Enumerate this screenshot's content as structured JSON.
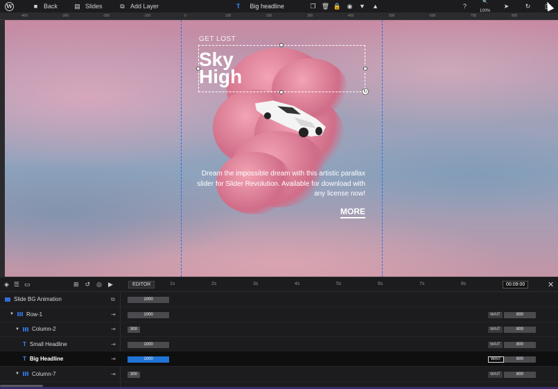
{
  "topbar": {
    "back_label": "Back",
    "slides_label": "Slides",
    "add_layer_label": "Add Layer",
    "layer_type_glyph": "T",
    "layer_name": "Big headline",
    "zoom_label": "100%"
  },
  "ruler": {
    "ticks": [
      "-400",
      "-300",
      "-200",
      "-100",
      "0",
      "100",
      "200",
      "300",
      "400",
      "500",
      "600",
      "700",
      "800"
    ]
  },
  "slide": {
    "eyebrow": "GET LOST",
    "headline_line1": "Sky",
    "headline_line2": "High",
    "description": "Dream the impossible dream with this artistic parallax slider for Slider Revolution. Available for download with any license now!",
    "cta": "MORE"
  },
  "timeline": {
    "editor_label": "EDITOR",
    "ticks": [
      "1s",
      "2s",
      "3s",
      "4s",
      "5s",
      "6s",
      "7s",
      "8s"
    ],
    "current_time": "00:09:00",
    "rows": [
      {
        "name": "Slide BG Animation",
        "bar": "1000",
        "wait": "",
        "end": ""
      },
      {
        "name": "Row-1",
        "bar": "1000",
        "wait": "WAIT",
        "end": "800"
      },
      {
        "name": "Column-2",
        "bar": "300",
        "wait": "WAIT",
        "end": "800"
      },
      {
        "name": "Small Headline",
        "bar": "1000",
        "wait": "WAIT",
        "end": "800"
      },
      {
        "name": "Big Headline",
        "bar": "1000",
        "wait": "WAIT",
        "end": "800"
      },
      {
        "name": "Column-7",
        "bar": "300",
        "wait": "WAIT",
        "end": "800"
      }
    ]
  },
  "colors": {
    "accent": "#1f74d6",
    "guide": "#2a6de0",
    "background": "#1c1c1e"
  }
}
